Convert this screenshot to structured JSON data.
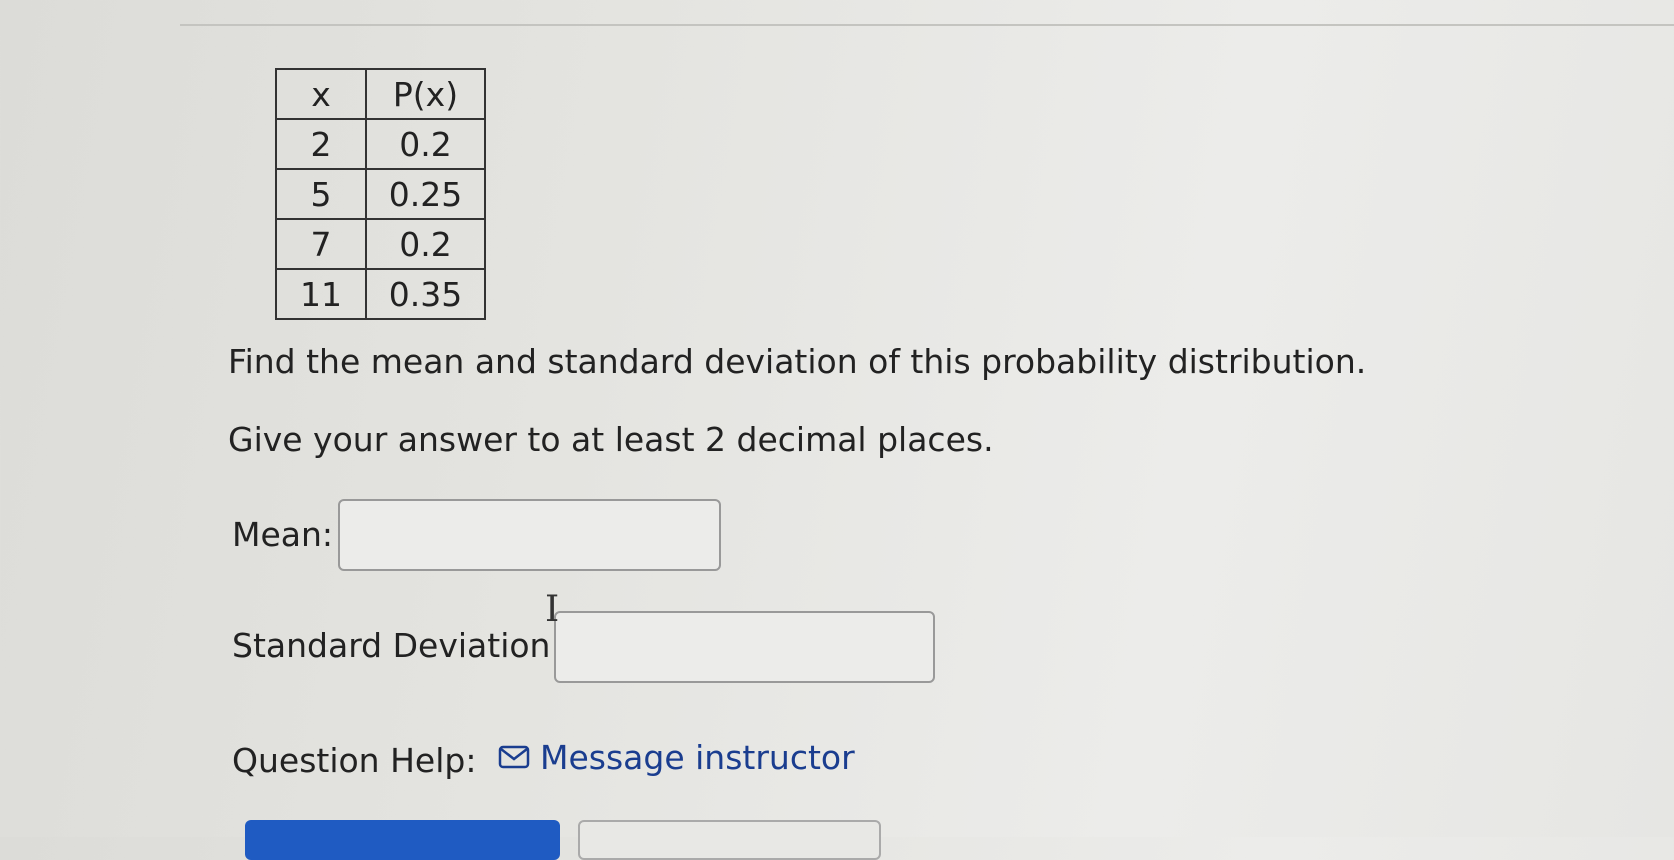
{
  "table": {
    "headers": [
      "x",
      "P(x)"
    ],
    "rows": [
      [
        "2",
        "0.2"
      ],
      [
        "5",
        "0.25"
      ],
      [
        "7",
        "0.2"
      ],
      [
        "11",
        "0.35"
      ]
    ]
  },
  "prompt": {
    "question": "Find the mean and standard deviation of this probability distribution.",
    "instruction": "Give your answer to at least 2 decimal places."
  },
  "fields": {
    "mean_label": "Mean:",
    "mean_value": "",
    "sd_label": "Standard Deviation:",
    "sd_value": ""
  },
  "help": {
    "label": "Question Help:",
    "link_text": "Message instructor",
    "icon": "envelope-icon"
  },
  "colors": {
    "link": "#1a3d8f",
    "primary_button": "#1f5bc2"
  }
}
